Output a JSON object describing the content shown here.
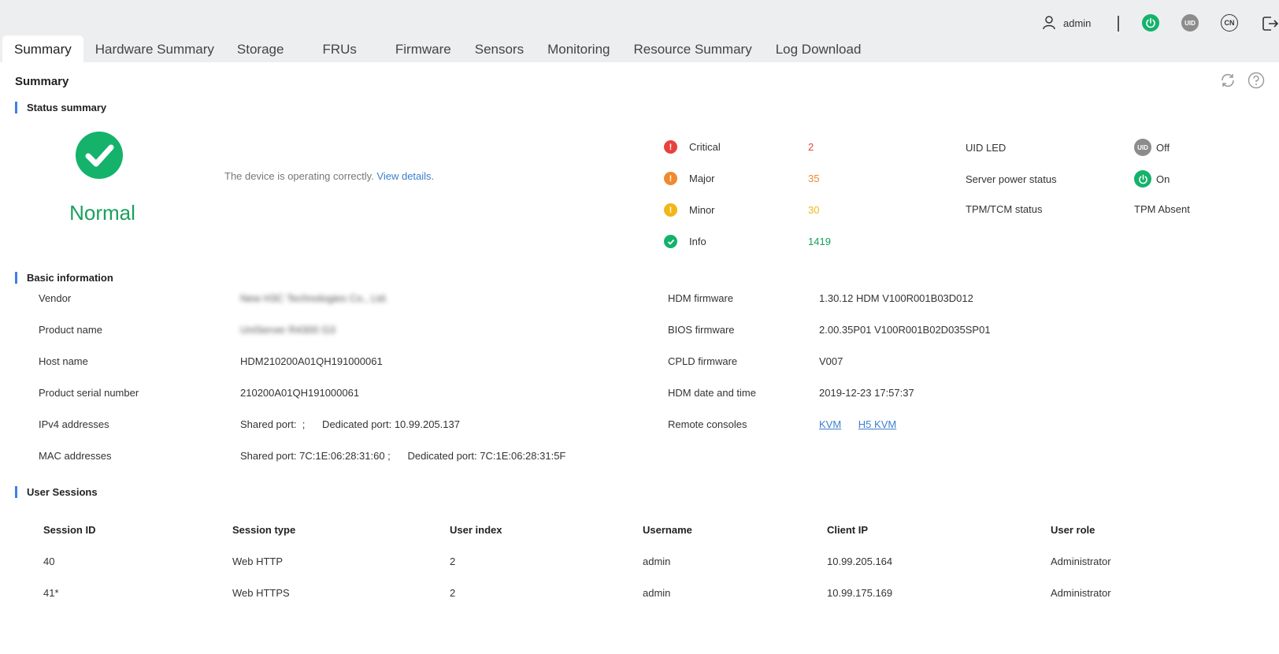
{
  "topbar": {
    "user": "admin",
    "uid_label": "UID",
    "lang_label": "CN"
  },
  "tabs": [
    {
      "label": "Summary",
      "active": true
    },
    {
      "label": "Hardware Summary"
    },
    {
      "label": "Storage"
    },
    {
      "label": "FRUs"
    },
    {
      "label": "Firmware"
    },
    {
      "label": "Sensors"
    },
    {
      "label": "Monitoring"
    },
    {
      "label": "Resource Summary"
    },
    {
      "label": "Log Download"
    }
  ],
  "page": {
    "title": "Summary"
  },
  "status_summary": {
    "title": "Status summary",
    "state": "Normal",
    "desc": "The device is operating correctly.",
    "link": "View details.",
    "alarms": [
      {
        "label": "Critical",
        "count": "2",
        "color": "#e8423f",
        "icon": "exclamation"
      },
      {
        "label": "Major",
        "count": "35",
        "color": "#f08a2e",
        "icon": "exclamation"
      },
      {
        "label": "Minor",
        "count": "30",
        "color": "#f2b619",
        "icon": "exclamation"
      },
      {
        "label": "Info",
        "count": "1419",
        "color": "#14b26b",
        "icon": "check"
      }
    ],
    "uid_led": {
      "label": "UID LED",
      "value": "Off",
      "badge": "UID"
    },
    "power": {
      "label": "Server power status",
      "value": "On"
    },
    "tpm": {
      "label": "TPM/TCM status",
      "value": "TPM Absent"
    }
  },
  "basic_info": {
    "title": "Basic information",
    "left": [
      {
        "k": "Vendor",
        "v": "New H3C Technologies Co., Ltd.",
        "blurred": true
      },
      {
        "k": "Product name",
        "v": "UniServer R4300 G3",
        "blurred": true
      },
      {
        "k": "Host name",
        "v": "HDM210200A01QH191000061"
      },
      {
        "k": "Product serial number",
        "v": "210200A01QH191000061"
      },
      {
        "k": "IPv4 addresses",
        "v": "Shared port:  ;      Dedicated port: 10.99.205.137"
      },
      {
        "k": "MAC addresses",
        "v": "Shared port: 7C:1E:06:28:31:60 ;      Dedicated port: 7C:1E:06:28:31:5F"
      }
    ],
    "right": [
      {
        "k": "HDM firmware",
        "v": "1.30.12 HDM V100R001B03D012"
      },
      {
        "k": "BIOS firmware",
        "v": "2.00.35P01 V100R001B02D035SP01"
      },
      {
        "k": "CPLD firmware",
        "v": "V007"
      },
      {
        "k": "HDM date and time",
        "v": "2019-12-23 17:57:37"
      }
    ],
    "remote": {
      "k": "Remote consoles",
      "links": [
        "KVM",
        "H5 KVM"
      ]
    }
  },
  "sessions": {
    "title": "User Sessions",
    "columns": [
      "Session ID",
      "Session type",
      "User index",
      "Username",
      "Client IP",
      "User role"
    ],
    "rows": [
      [
        "40",
        "Web HTTP",
        "2",
        "admin",
        "10.99.205.164",
        "Administrator"
      ],
      [
        "41*",
        "Web HTTPS",
        "2",
        "admin",
        "10.99.175.169",
        "Administrator"
      ]
    ]
  }
}
